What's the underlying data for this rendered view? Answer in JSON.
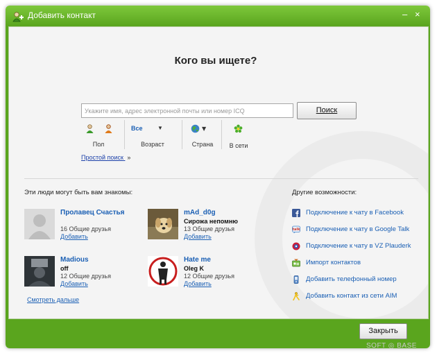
{
  "window": {
    "title": "Добавить контакт",
    "minimize": "–",
    "close": "×"
  },
  "search": {
    "heading": "Кого вы ищете?",
    "placeholder": "Укажите имя, адрес электронной почты или номер ICQ",
    "button": "Поиск",
    "simple_search": "Простой поиск"
  },
  "filters": {
    "gender": "Пол",
    "age_value": "Все",
    "age": "Возраст",
    "country": "Страна",
    "online": "В сети"
  },
  "suggestions": {
    "title": "Эти люди могут быть вам знакомы:",
    "see_more": "Смотреть дальше",
    "people": [
      {
        "name": "Пролавец Счастья",
        "subtitle": "",
        "friends": "16 Общие друзья",
        "add": "Добавить"
      },
      {
        "name": "mAd_d0g",
        "subtitle": "Сирожа непомню",
        "friends": "13 Общие друзья",
        "add": "Добавить"
      },
      {
        "name": "Madious",
        "subtitle": "off",
        "friends": "12 Общие друзья",
        "add": "Добавить"
      },
      {
        "name": "Hate me",
        "subtitle": "Oleg K",
        "friends": "12 Общие друзья",
        "add": "Добавить"
      }
    ]
  },
  "options": {
    "title": "Другие возможности:",
    "items": [
      {
        "label": "Подключение к чату в Facebook",
        "icon": "facebook-icon"
      },
      {
        "label": "Подключение к чату в Google Talk",
        "icon": "google-talk-icon"
      },
      {
        "label": "Подключение к чату в VZ Plauderk",
        "icon": "vz-icon"
      },
      {
        "label": "Импорт контактов",
        "icon": "import-contacts-icon"
      },
      {
        "label": "Добавить телефонный номер",
        "icon": "phone-icon"
      },
      {
        "label": "Добавить контакт из сети AIM",
        "icon": "aim-icon"
      }
    ]
  },
  "footer": {
    "close_button": "Закрыть"
  },
  "watermark": "SOFT ◎ BASE",
  "colors": {
    "frame": "#5aa51e",
    "link": "#1a5fb4",
    "background": "#f4f4f4"
  }
}
